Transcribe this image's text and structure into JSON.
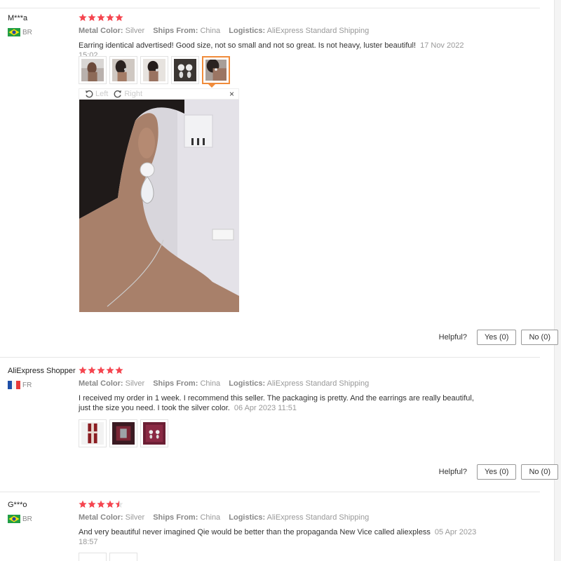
{
  "reviews": [
    {
      "user": "M***a",
      "country": "BR",
      "rating": 5,
      "meta": [
        {
          "key": "Metal Color:",
          "value": "Silver"
        },
        {
          "key": "Ships From:",
          "value": "China"
        },
        {
          "key": "Logistics:",
          "value": "AliExpress Standard Shipping"
        }
      ],
      "text": "Earring identical advertised! Good size, not so small and not so great. Is not heavy, luster beautiful!",
      "date": "17 Nov 2022 15:02",
      "thumbnail_count": 5,
      "active_thumbnail": 5,
      "viewer": {
        "left": "Left",
        "right": "Right",
        "close": "×"
      }
    },
    {
      "user": "AliExpress Shopper",
      "country": "FR",
      "rating": 5,
      "meta": [
        {
          "key": "Metal Color:",
          "value": "Silver"
        },
        {
          "key": "Ships From:",
          "value": "China"
        },
        {
          "key": "Logistics:",
          "value": "AliExpress Standard Shipping"
        }
      ],
      "text": "I received my order in 1 week. I recommend this seller. The packaging is pretty. And the earrings are really beautiful, just the size you need. I took the silver color.",
      "date": "06 Apr 2023 11:51",
      "thumbnail_count": 3
    },
    {
      "user": "G***o",
      "country": "BR",
      "rating": 4.5,
      "meta": [
        {
          "key": "Metal Color:",
          "value": "Silver"
        },
        {
          "key": "Ships From:",
          "value": "China"
        },
        {
          "key": "Logistics:",
          "value": "AliExpress Standard Shipping"
        }
      ],
      "text": "And very beautiful never imagined Qie would be better than the propaganda New Vice called aliexpless",
      "date": "05 Apr 2023 18:57"
    }
  ],
  "helpful": {
    "label": "Helpful?",
    "yes": "Yes (0)",
    "no": "No (0)"
  },
  "colors": {
    "star": "#f5454f",
    "accent": "#f08b3a"
  }
}
